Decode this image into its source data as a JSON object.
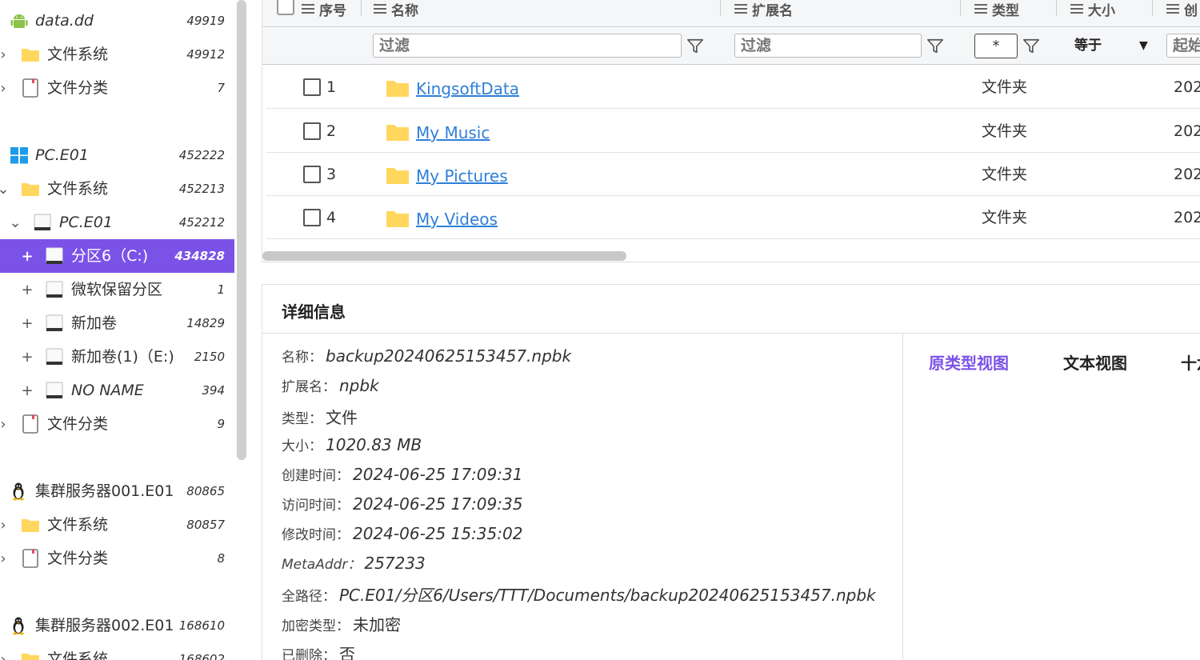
{
  "sidebar": {
    "items": [
      {
        "label": "data.dd",
        "count": "49919",
        "icon": "android-icon"
      },
      {
        "label": "文件系统",
        "count": "49912",
        "icon": "folder-icon"
      },
      {
        "label": "文件分类",
        "count": "7",
        "icon": "document-icon"
      },
      {
        "label": "PC.E01",
        "count": "452222",
        "icon": "windows-icon"
      },
      {
        "label": "文件系统",
        "count": "452213",
        "icon": "folder-icon"
      },
      {
        "label": "PC.E01",
        "count": "452212",
        "icon": "drive-icon"
      },
      {
        "label": "分区6（C:)",
        "count": "434828",
        "icon": "drive-icon",
        "selected": true
      },
      {
        "label": "微软保留分区",
        "count": "1",
        "icon": "drive-icon"
      },
      {
        "label": "新加卷",
        "count": "14829",
        "icon": "drive-icon"
      },
      {
        "label": "新加卷(1)（E:)",
        "count": "2150",
        "icon": "drive-icon"
      },
      {
        "label": "NO NAME",
        "count": "394",
        "icon": "drive-icon"
      },
      {
        "label": "文件分类",
        "count": "9",
        "icon": "document-icon"
      },
      {
        "label": "集群服务器001.E01",
        "count": "80865",
        "icon": "linux-icon"
      },
      {
        "label": "文件系统",
        "count": "80857",
        "icon": "folder-icon"
      },
      {
        "label": "文件分类",
        "count": "8",
        "icon": "document-icon"
      },
      {
        "label": "集群服务器002.E01",
        "count": "168610",
        "icon": "linux-icon"
      },
      {
        "label": "文件系统",
        "count": "168602",
        "icon": "folder-icon"
      }
    ],
    "toggles": {
      "collapsed": "›",
      "expanded": "⌄",
      "plus": "+"
    }
  },
  "grid": {
    "columns": {
      "index": "序号",
      "name": "名称",
      "ext": "扩展名",
      "type": "类型",
      "size": "大小",
      "created": "创"
    },
    "filters": {
      "name_placeholder": "过滤",
      "ext_placeholder": "过滤",
      "type_value": "*",
      "size_operator": "等于",
      "size_arrow": "▼",
      "created_placeholder": "起始"
    },
    "rows": [
      {
        "index": "1",
        "name": "KingsoftData",
        "type": "文件夹",
        "created": "202"
      },
      {
        "index": "2",
        "name": "My Music",
        "type": "文件夹",
        "created": "202"
      },
      {
        "index": "3",
        "name": "My Pictures",
        "type": "文件夹",
        "created": "202"
      },
      {
        "index": "4",
        "name": "My Videos",
        "type": "文件夹",
        "created": "202"
      }
    ]
  },
  "details": {
    "title": "详细信息",
    "props": [
      {
        "label": "名称：",
        "value": "backup20240625153457.npbk"
      },
      {
        "label": "扩展名：",
        "value": "npbk"
      },
      {
        "label": "类型：",
        "value": "文件"
      },
      {
        "label": "大小：",
        "value": "1020.83 MB"
      },
      {
        "label": "创建时间：",
        "value": "2024-06-25 17:09:31"
      },
      {
        "label": "访问时间：",
        "value": "2024-06-25 17:09:35"
      },
      {
        "label": "修改时间：",
        "value": "2024-06-25 15:35:02"
      },
      {
        "label": "MetaAddr：",
        "value": "257233"
      },
      {
        "label": "全路径：",
        "value": "PC.E01/分区6/Users/TTT/Documents/backup20240625153457.npbk"
      },
      {
        "label": "加密类型：",
        "value": "未加密"
      },
      {
        "label": "已删除：",
        "value": "否"
      }
    ],
    "tabs": {
      "original": "原类型视图",
      "text": "文本视图",
      "hex": "十六"
    }
  },
  "colors": {
    "accent": "#7b52e8",
    "link": "#2f7fd8",
    "folder": "#ffd75e",
    "android": "#8bc34a",
    "windows": "#1e9be9"
  }
}
